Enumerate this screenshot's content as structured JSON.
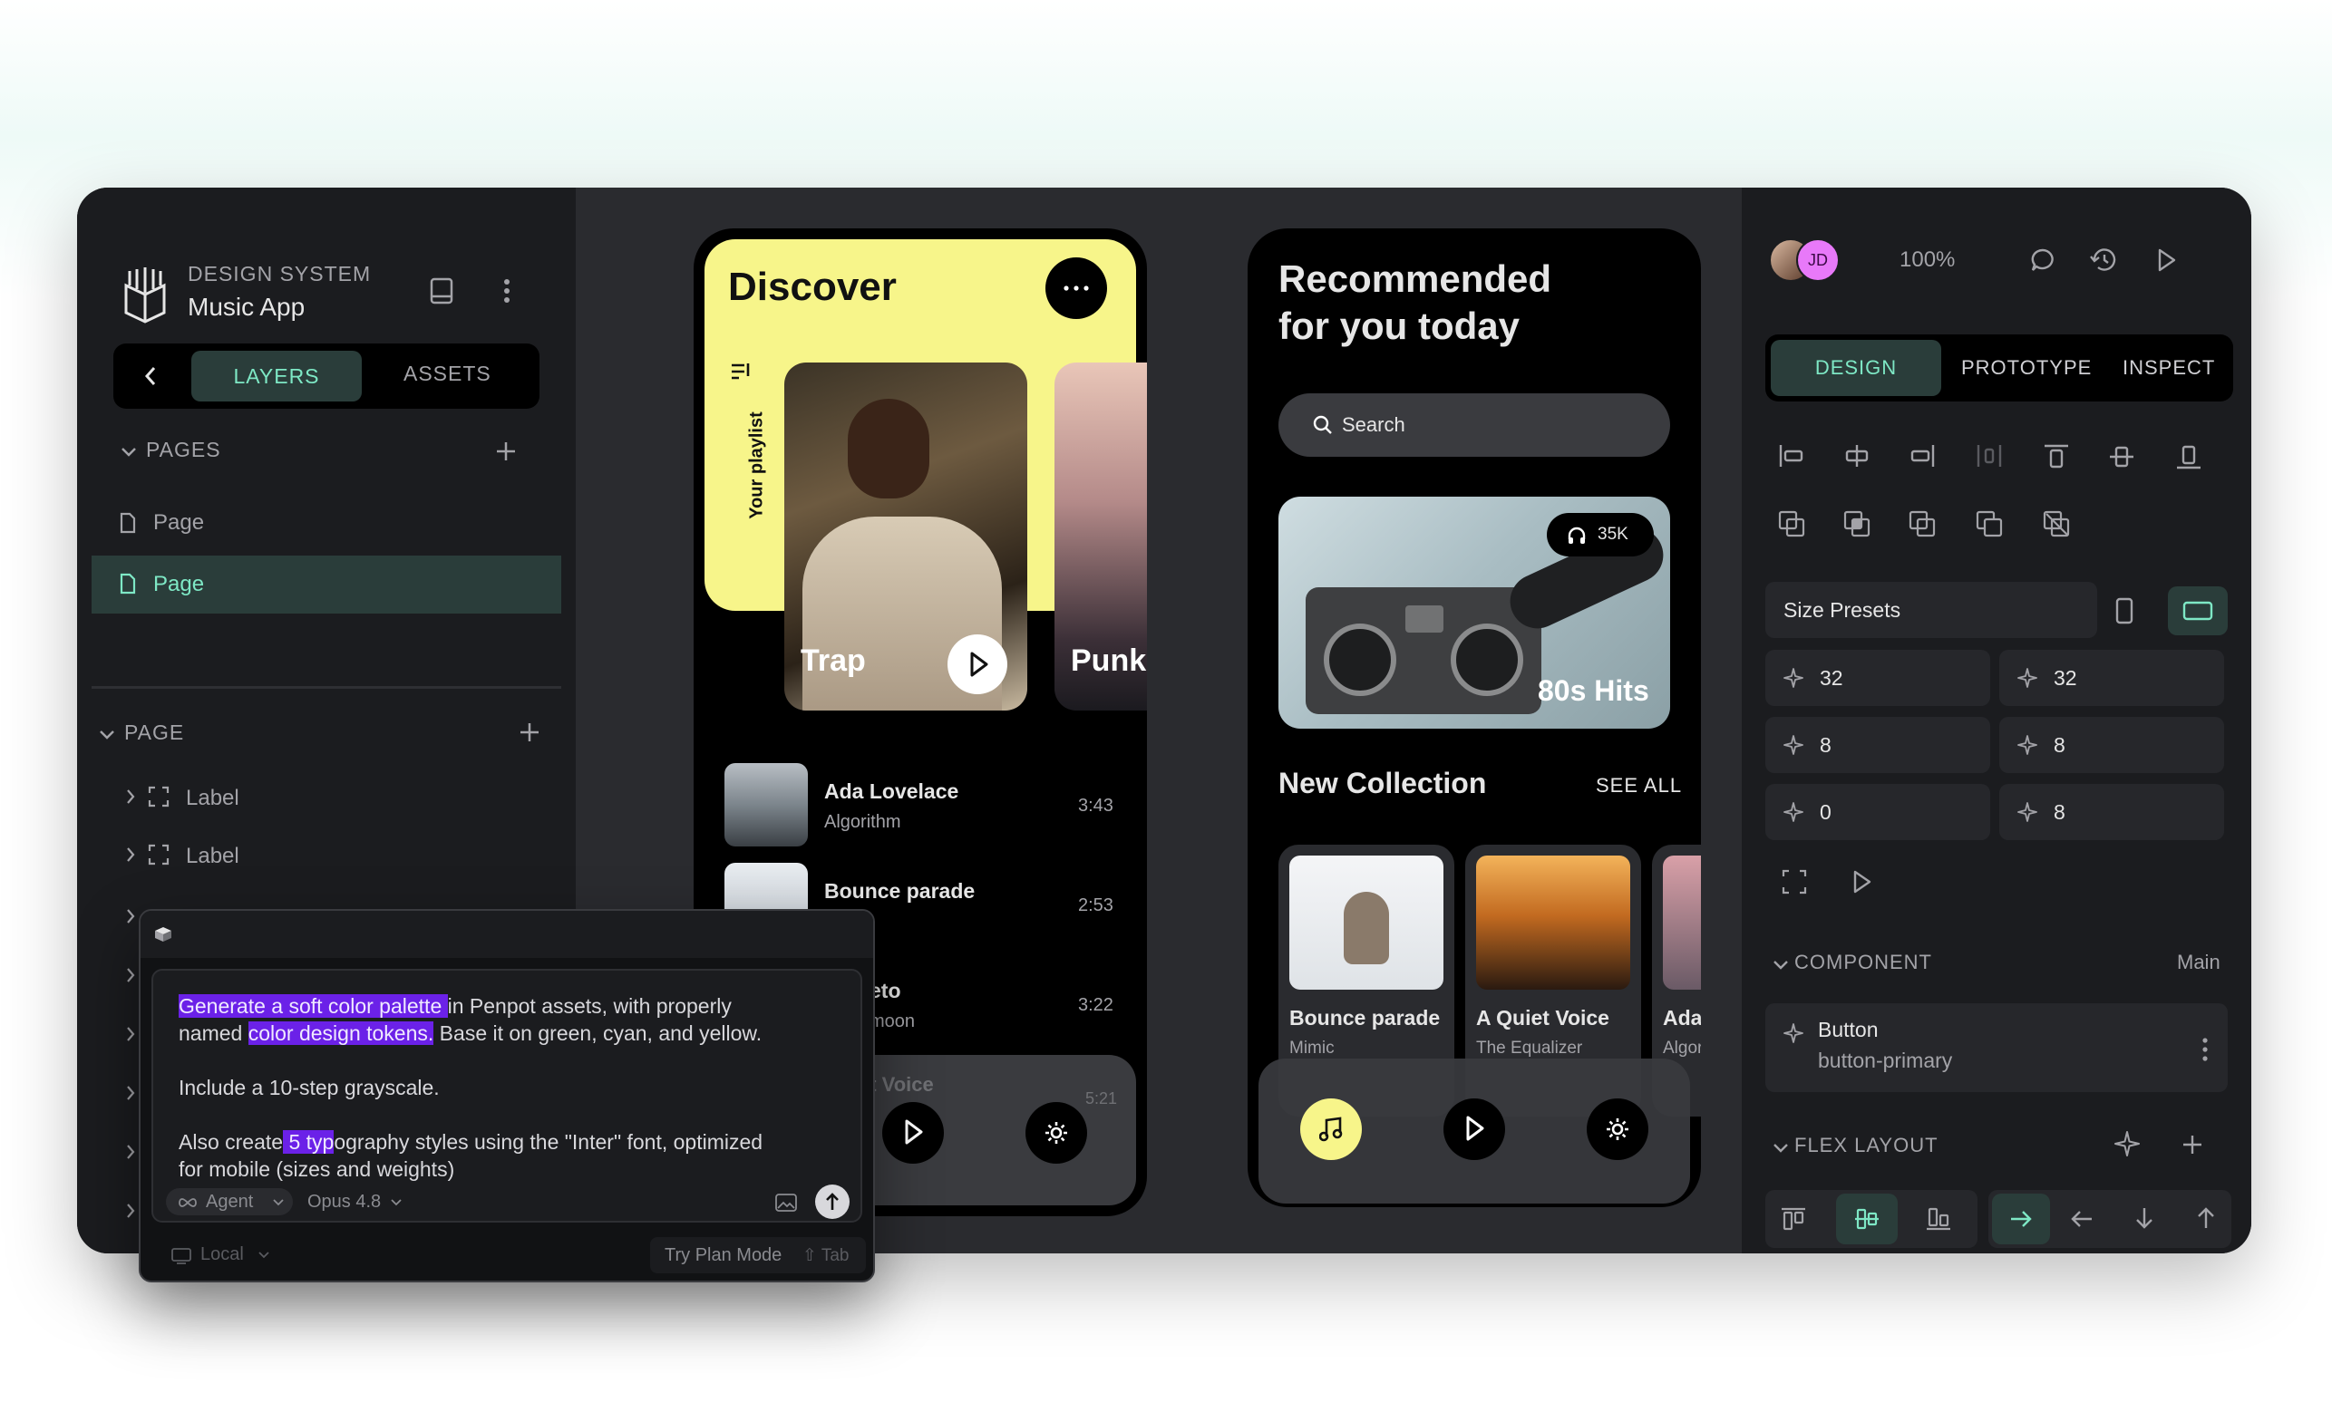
{
  "sidebar": {
    "project_label": "DESIGN SYSTEM",
    "project_name": "Music App",
    "tabs": [
      "LAYERS",
      "ASSETS"
    ],
    "pages_header": "PAGES",
    "pages": [
      "Page",
      "Page"
    ],
    "page_header": "PAGE",
    "layers": [
      "Label",
      "Label"
    ]
  },
  "discover": {
    "title": "Discover",
    "playlist_label": "Your playlist",
    "cards": [
      "Trap",
      "Punk"
    ],
    "tracks": [
      {
        "title": "Ada Lovelace",
        "artist": "Algorithm",
        "duration": "3:43"
      },
      {
        "title": "Bounce parade",
        "artist": "",
        "duration": "2:53"
      },
      {
        "title": "eto",
        "artist": "moon",
        "duration": "3:22"
      }
    ],
    "now_playing": "et Voice",
    "now_time": "5:21"
  },
  "recommend": {
    "title_line1": "Recommended",
    "title_line2": "for you today",
    "search_placeholder": "Search",
    "hero_badge": "35K",
    "hero_title": "80s Hits",
    "collection_title": "New Collection",
    "see_all": "SEE ALL",
    "collection": [
      {
        "title": "Bounce parade",
        "artist": "Mimic"
      },
      {
        "title": "A Quiet Voice",
        "artist": "The Equalizer"
      },
      {
        "title": "Ada",
        "artist": "Algor"
      }
    ]
  },
  "inspector": {
    "avatar_initials": "JD",
    "zoom": "100%",
    "tabs": [
      "DESIGN",
      "PROTOTYPE",
      "INSPECT"
    ],
    "size_presets": "Size Presets",
    "values": [
      "32",
      "32",
      "8",
      "8",
      "0",
      "8"
    ],
    "component_header": "COMPONENT",
    "component_main": "Main",
    "component_name": "Button",
    "component_variant": "button-primary",
    "flex_header": "FLEX LAYOUT"
  },
  "chat": {
    "para1_hl1": "Generate a soft color palette ",
    "para1_t1": "in Penpot assets,  with properly",
    "para1_t2": "named ",
    "para1_hl2": "color design tokens.",
    "para1_t3": " Base it on green, cyan, and yellow.",
    "para2": "Include a 10-step grayscale.",
    "para3_t1": "Also create",
    "para3_hl": " 5 typ",
    "para3_t2": "ography styles using the \"Inter\" font, optimized",
    "para3_t3": "for mobile (sizes and weights)",
    "mode": "Agent",
    "model": "Opus 4.8",
    "env": "Local",
    "plan_mode": "Try Plan Mode",
    "tab_hint": "⇧ Tab"
  },
  "colors": {
    "accent": "#7ee8c5",
    "yellow": "#f7f58a",
    "highlight": "#6b21e8",
    "avatar": "#e879f9"
  }
}
